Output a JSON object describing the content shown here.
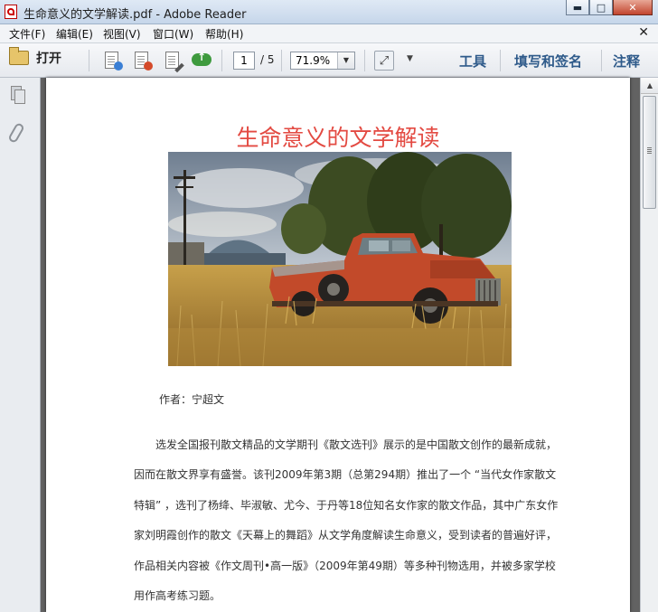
{
  "window": {
    "title": "生命意义的文学解读.pdf - Adobe Reader",
    "minimize": "▬",
    "maximize": "□",
    "close": "✕"
  },
  "menu": {
    "items": [
      "文件(F)",
      "编辑(E)",
      "视图(V)",
      "窗口(W)",
      "帮助(H)"
    ],
    "close_glyph": "✕"
  },
  "toolbar": {
    "open_label": "打开",
    "current_page": "1",
    "total_pages": "/ 5",
    "zoom": "71.9%",
    "tools_label": "工具",
    "sign_label": "填写和签名",
    "comment_label": "注释"
  },
  "document": {
    "title": "生命意义的文学解读",
    "author": "作者：宁超文",
    "paragraph_lines": [
      "选发全国报刊散文精品的文学期刊《散文选刊》展示的是中国散文创作的最新成就，",
      "因而在散文界享有盛誉。该刊2009年第3期（总第294期）推出了一个 “当代女作家散文",
      "特辑” ，选刊了杨绛、毕淑敏、尤今、于丹等18位知名女作家的散文作品，其中广东女作",
      "家刘明霞创作的散文《天幕上的舞蹈》从文学角度解读生命意义，受到读者的普遍好评，",
      "作品相关内容被《作文周刊•高一版》（2009年第49期）等多种刊物选用，并被多家学校",
      "用作高考练习题。"
    ]
  },
  "colors": {
    "title_red": "#e34a42",
    "link_blue": "#2e5a8a"
  }
}
